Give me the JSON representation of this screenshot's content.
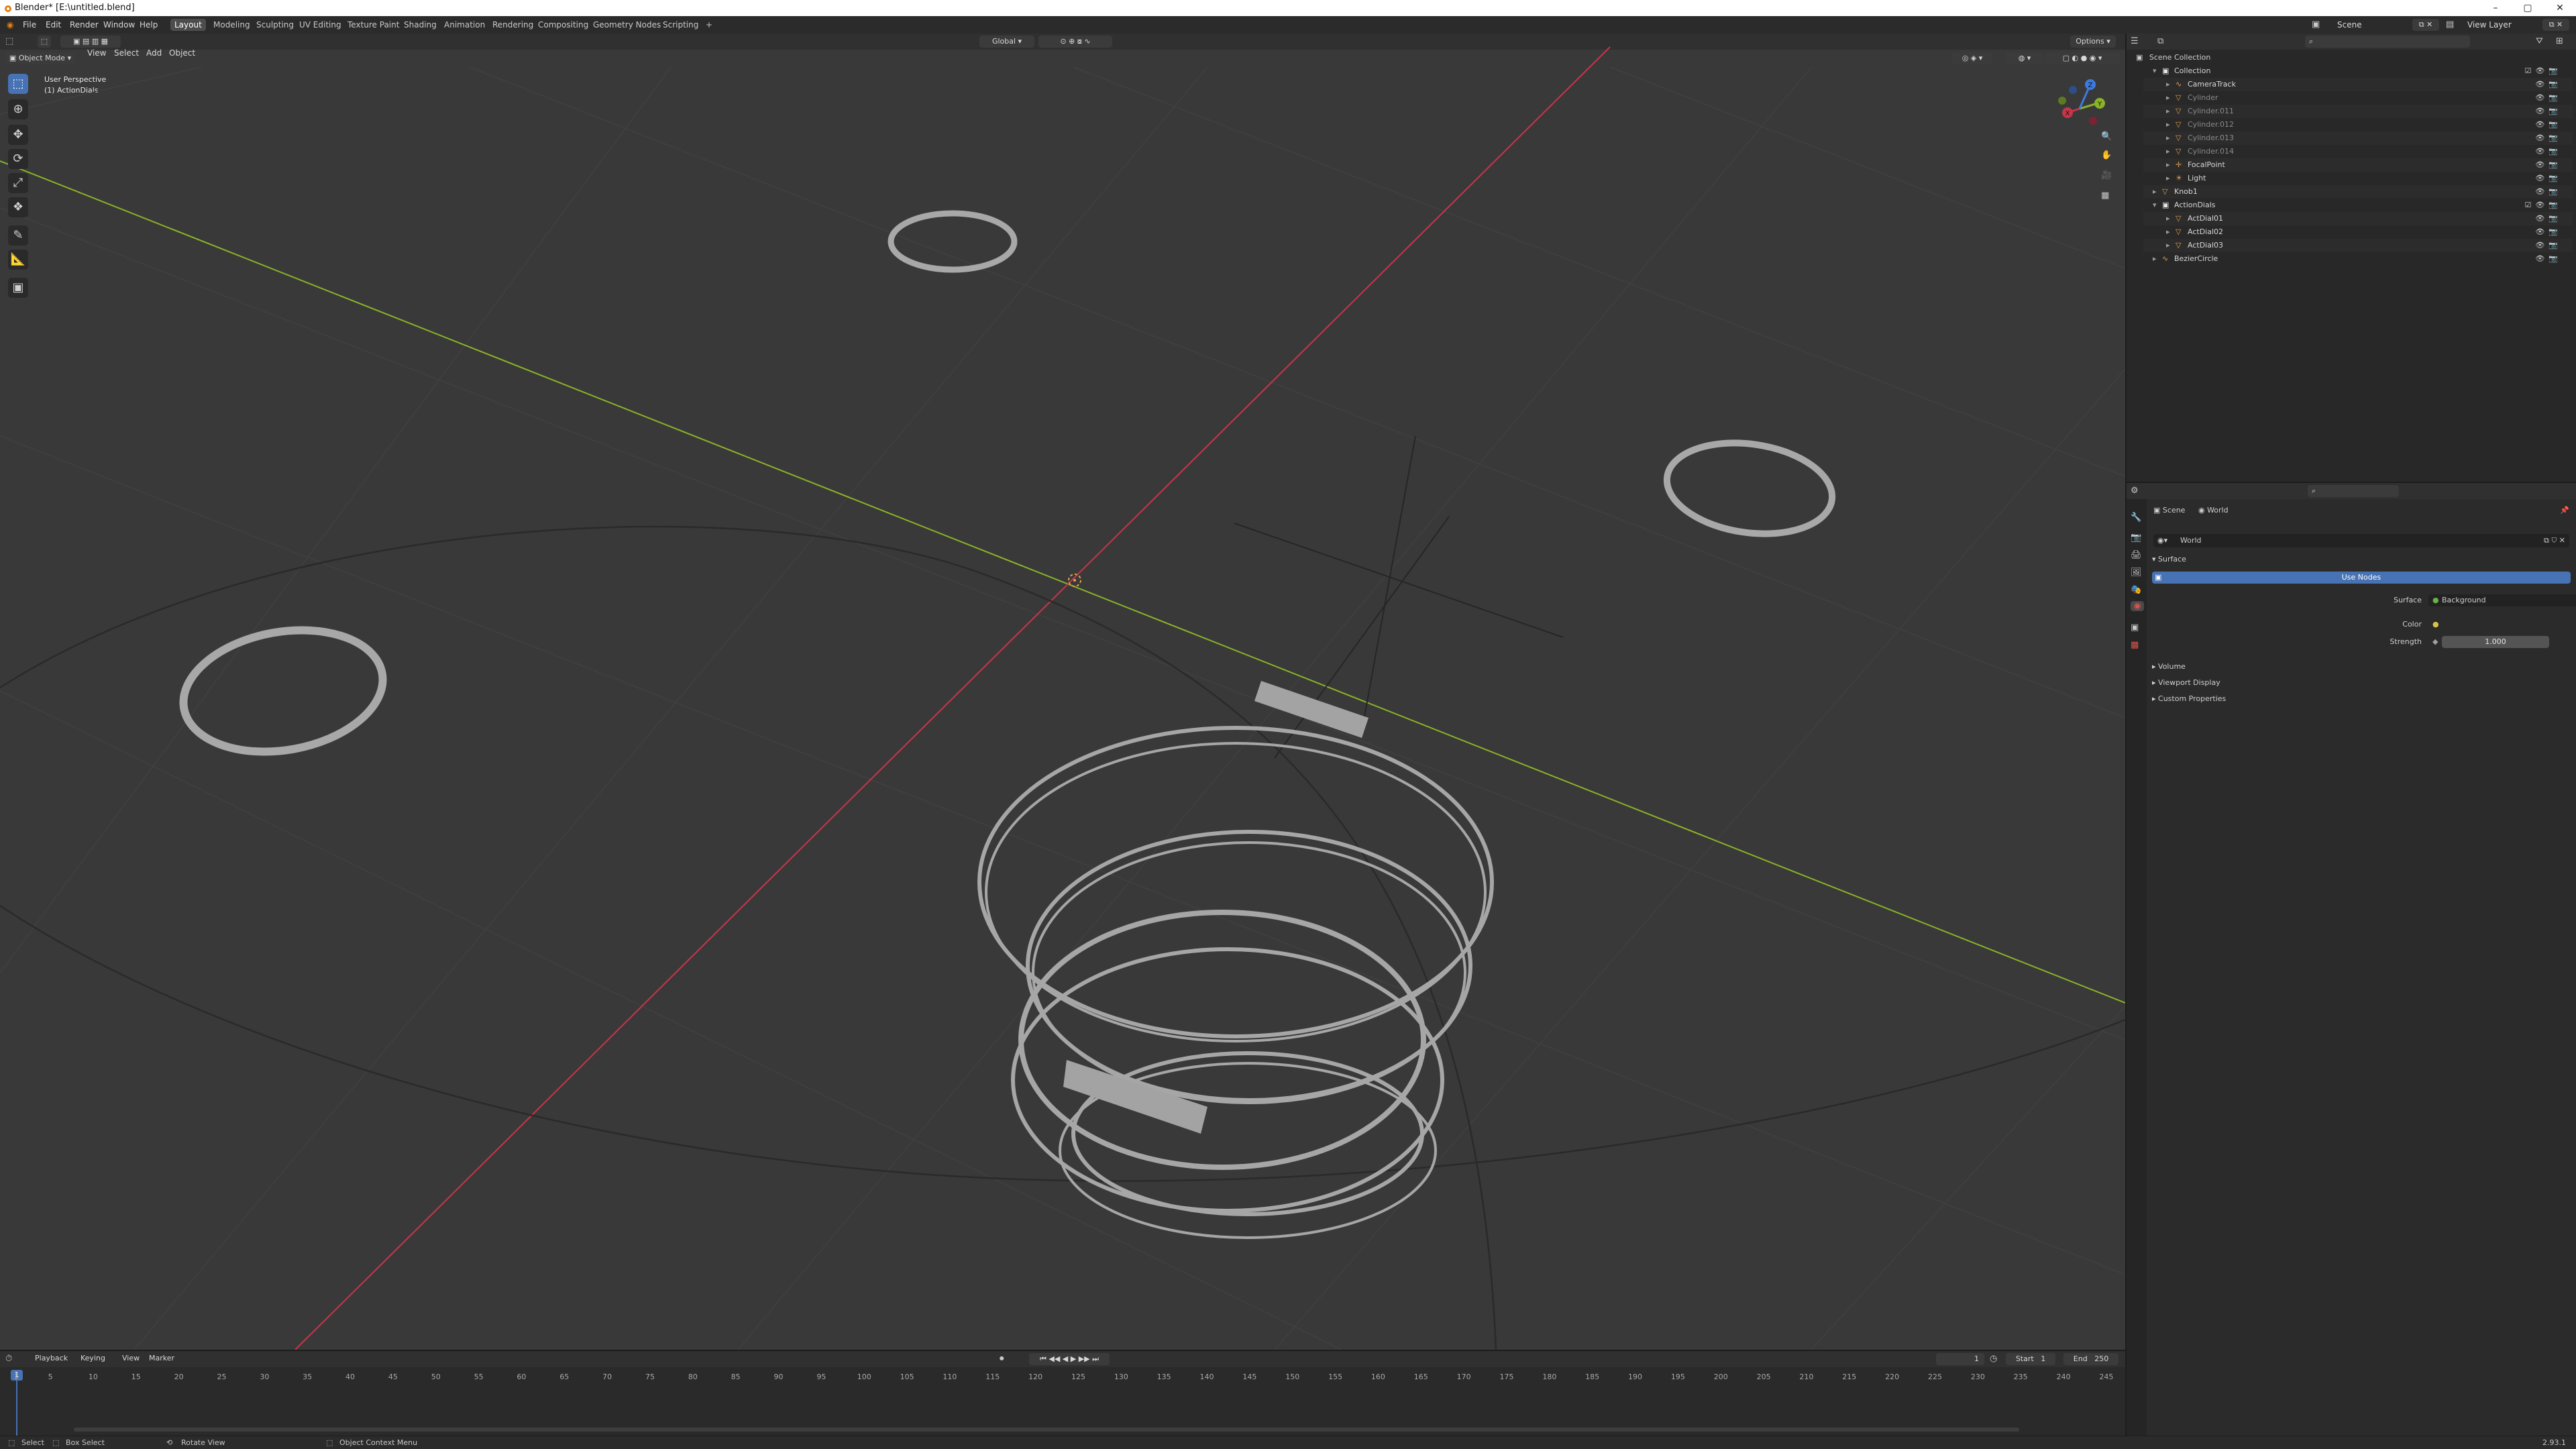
{
  "window": {
    "title": "Blender* [E:\\untitled.blend]",
    "minimize": "–",
    "maximize": "▢",
    "close": "✕"
  },
  "menu": [
    "File",
    "Edit",
    "Render",
    "Window",
    "Help"
  ],
  "workspaces": [
    "Layout",
    "Modeling",
    "Sculpting",
    "UV Editing",
    "Texture Paint",
    "Shading",
    "Animation",
    "Rendering",
    "Compositing",
    "Geometry Nodes",
    "Scripting"
  ],
  "workspace_add": "+",
  "scene": {
    "label": "Scene",
    "view_layer": "View Layer"
  },
  "viewport": {
    "mode": "Object Mode",
    "menus": [
      "View",
      "Select",
      "Add",
      "Object"
    ],
    "orientation": "Global",
    "options": "Options",
    "overlay_title": "User Perspective",
    "overlay_subtitle": "(1) ActionDials",
    "gizmo": {
      "x": "X",
      "y": "Y",
      "z": "Z"
    }
  },
  "outliner": {
    "root": "Scene Collection",
    "rows": [
      {
        "name": "Collection",
        "depth": 0,
        "type": "collection",
        "dim": false
      },
      {
        "name": "CameraTrack",
        "depth": 1,
        "type": "curve",
        "dim": false
      },
      {
        "name": "Cylinder",
        "depth": 1,
        "type": "mesh",
        "dim": true
      },
      {
        "name": "Cylinder.011",
        "depth": 1,
        "type": "mesh",
        "dim": true
      },
      {
        "name": "Cylinder.012",
        "depth": 1,
        "type": "mesh",
        "dim": true
      },
      {
        "name": "Cylinder.013",
        "depth": 1,
        "type": "mesh",
        "dim": true
      },
      {
        "name": "Cylinder.014",
        "depth": 1,
        "type": "mesh",
        "dim": true
      },
      {
        "name": "FocalPoint",
        "depth": 1,
        "type": "empty",
        "dim": false
      },
      {
        "name": "Light",
        "depth": 1,
        "type": "light",
        "dim": false
      },
      {
        "name": "Knob1",
        "depth": 0,
        "type": "mesh",
        "dim": false
      },
      {
        "name": "ActionDials",
        "depth": 0,
        "type": "collection",
        "dim": false
      },
      {
        "name": "ActDial01",
        "depth": 1,
        "type": "mesh",
        "dim": false
      },
      {
        "name": "ActDial02",
        "depth": 1,
        "type": "mesh",
        "dim": false
      },
      {
        "name": "ActDial03",
        "depth": 1,
        "type": "mesh",
        "dim": false
      },
      {
        "name": "BezierCircle",
        "depth": 0,
        "type": "curve",
        "dim": false
      }
    ]
  },
  "properties": {
    "tabs_path": [
      "Scene",
      "World"
    ],
    "world_name": "World",
    "surface_panel": "Surface",
    "use_nodes": "Use Nodes",
    "surface_label": "Surface",
    "surface_value": "Background",
    "color_label": "Color",
    "strength_label": "Strength",
    "strength_value": "1.000",
    "collapsed_panels": [
      "Volume",
      "Viewport Display",
      "Custom Properties"
    ]
  },
  "timeline": {
    "menus": [
      "Playback",
      "Keying",
      "View",
      "Marker"
    ],
    "current_frame": "1",
    "start_label": "Start",
    "start": "1",
    "end_label": "End",
    "end": "250",
    "ticks": [
      "1",
      "5",
      "10",
      "15",
      "20",
      "25",
      "30",
      "35",
      "40",
      "45",
      "50",
      "55",
      "60",
      "65",
      "70",
      "75",
      "80",
      "85",
      "90",
      "95",
      "100",
      "105",
      "110",
      "115",
      "120",
      "125",
      "130",
      "135",
      "140",
      "145",
      "150",
      "155",
      "160",
      "165",
      "170",
      "175",
      "180",
      "185",
      "190",
      "195",
      "200",
      "205",
      "210",
      "215",
      "220",
      "225",
      "230",
      "235",
      "240",
      "245"
    ]
  },
  "status": {
    "select": "Select",
    "box_select": "Box Select",
    "rotate_view": "Rotate View",
    "context_menu": "Object Context Menu",
    "version": "2.93.1"
  },
  "colors": {
    "accent": "#4772b3",
    "x_axis": "#c8354a",
    "y_axis": "#8ab327",
    "z_axis": "#3b7be0",
    "viewport_bg": "#393939"
  }
}
